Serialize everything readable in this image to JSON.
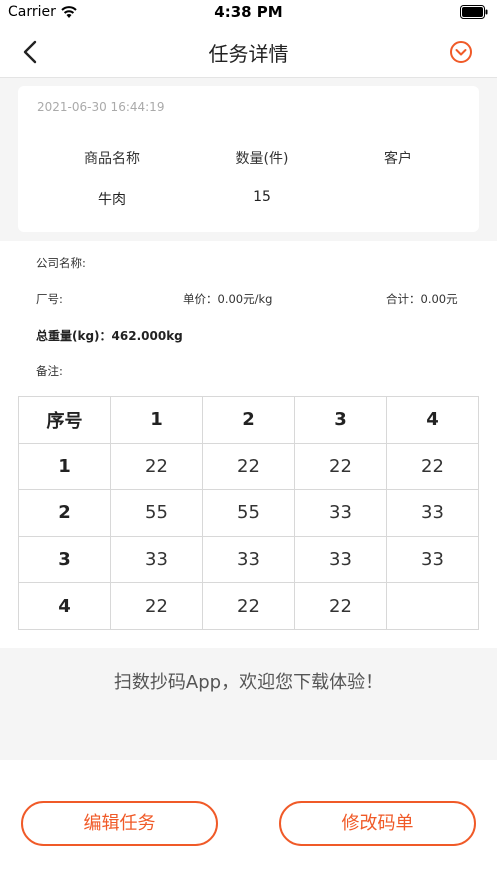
{
  "status": {
    "carrier": "Carrier",
    "time": "4:38 PM"
  },
  "nav": {
    "title": "任务详情",
    "back_icon": "chevron-left-icon",
    "dropdown_icon": "circle-chevron-down-icon"
  },
  "card": {
    "date": "2021-06-30 16:44:19",
    "columns": [
      "商品名称",
      "数量(件)",
      "客户"
    ],
    "values": [
      "牛肉",
      "15",
      ""
    ]
  },
  "info": {
    "company_label": "公司名称:",
    "factory_label": "厂号:",
    "unit_price": "单价：0.00元/kg",
    "total": "合计：0.00元",
    "total_weight": "总重量(kg)：462.000kg",
    "remark_label": "备注:"
  },
  "table": {
    "header": [
      "序号",
      "1",
      "2",
      "3",
      "4"
    ],
    "rows": [
      [
        "1",
        "22",
        "22",
        "22",
        "22"
      ],
      [
        "2",
        "55",
        "55",
        "33",
        "33"
      ],
      [
        "3",
        "33",
        "33",
        "33",
        "33"
      ],
      [
        "4",
        "22",
        "22",
        "22",
        ""
      ]
    ]
  },
  "promo": {
    "text": "扫数抄码App，欢迎您下载体验！"
  },
  "buttons": {
    "edit": "编辑任务",
    "modify": "修改码单"
  },
  "colors": {
    "accent": "#f05a28",
    "background_gray": "#f5f5f5"
  }
}
